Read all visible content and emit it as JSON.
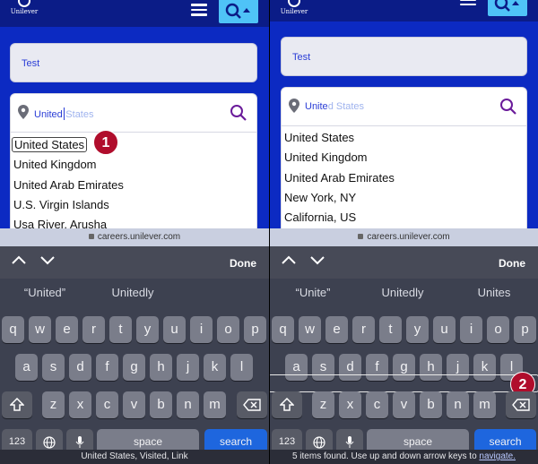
{
  "left": {
    "logo_text": "Unilever",
    "text_field_value": "Test",
    "location_typed": "United",
    "location_ghost": "States",
    "options": [
      "United States",
      "United Kingdom",
      "United Arab Emirates",
      "U.S. Virgin Islands",
      "Usa River, Arusha"
    ],
    "badge": "1",
    "url": "careers.unilever.com",
    "done_label": "Done",
    "suggestions": [
      "“United”",
      "Unitedly"
    ],
    "status_text": "United States, Visited, Link"
  },
  "right": {
    "logo_text": "Unilever",
    "text_field_value": "Test",
    "location_typed": "Unite",
    "location_ghost": "d States",
    "options": [
      "United States",
      "United Kingdom",
      "United Arab Emirates",
      "New York, NY",
      "California, US"
    ],
    "badge": "2",
    "url": "careers.unilever.com",
    "done_label": "Done",
    "suggestions": [
      "“Unite”",
      "Unitedly",
      "Unites"
    ],
    "status_text": "5 items found. Use up and down arrow keys to ",
    "status_link": "navigate."
  },
  "keyboard": {
    "row1": [
      "q",
      "w",
      "e",
      "r",
      "t",
      "y",
      "u",
      "i",
      "o",
      "p"
    ],
    "row2": [
      "a",
      "s",
      "d",
      "f",
      "g",
      "h",
      "j",
      "k",
      "l"
    ],
    "row3": [
      "z",
      "x",
      "c",
      "v",
      "b",
      "n",
      "m"
    ],
    "numbers_label": "123",
    "space_label": "space",
    "search_label": "search"
  },
  "colors": {
    "header": "#0b1c87",
    "page_blue": "#0c2ac2",
    "search_button": "#4fc3f7",
    "badge": "#b00d2c",
    "keyboard_bg": "#3d4150",
    "search_key": "#1e66de"
  }
}
